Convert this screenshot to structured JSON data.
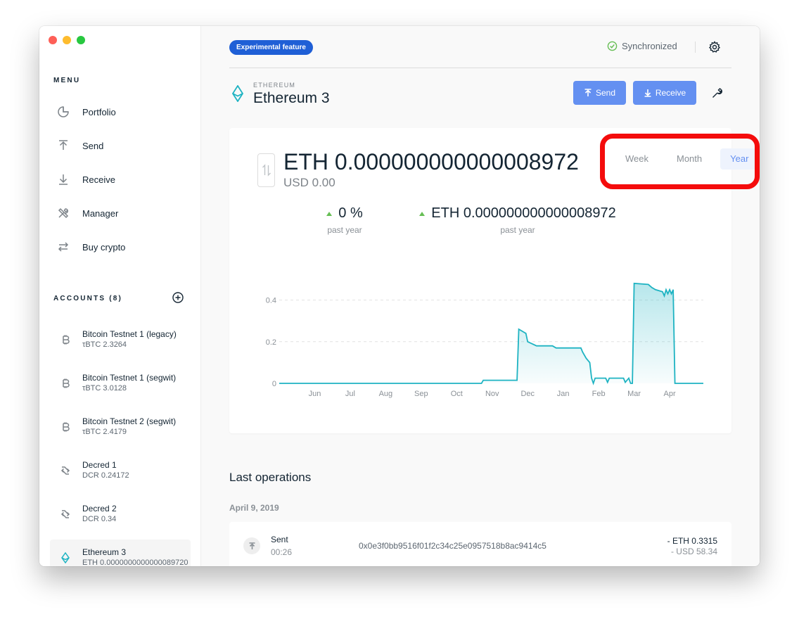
{
  "sidebar": {
    "menu_title": "MENU",
    "menu": [
      {
        "label": "Portfolio",
        "icon": "pie-chart-icon"
      },
      {
        "label": "Send",
        "icon": "arrow-up-icon"
      },
      {
        "label": "Receive",
        "icon": "arrow-down-icon"
      },
      {
        "label": "Manager",
        "icon": "tools-icon"
      },
      {
        "label": "Buy crypto",
        "icon": "exchange-icon"
      }
    ],
    "accounts_title": "ACCOUNTS (8)",
    "accounts": [
      {
        "name": "Bitcoin Testnet 1 (legacy)",
        "balance": "τBTC 2.3264",
        "icon": "bitcoin-icon"
      },
      {
        "name": "Bitcoin Testnet 1 (segwit)",
        "balance": "τBTC 3.0128",
        "icon": "bitcoin-icon"
      },
      {
        "name": "Bitcoin Testnet 2 (segwit)",
        "balance": "τBTC 2.4179",
        "icon": "bitcoin-icon"
      },
      {
        "name": "Decred 1",
        "balance": "DCR 0.24172",
        "icon": "decred-icon"
      },
      {
        "name": "Decred 2",
        "balance": "DCR 0.34",
        "icon": "decred-icon"
      },
      {
        "name": "Ethereum 3",
        "balance": "ETH 0.0000000000000089720",
        "icon": "ethereum-icon",
        "active": true
      }
    ]
  },
  "topbar": {
    "badge": "Experimental feature",
    "sync_status": "Synchronized"
  },
  "account": {
    "currency_label": "ETHEREUM",
    "name": "Ethereum 3",
    "send_label": "Send",
    "receive_label": "Receive"
  },
  "balance": {
    "main": "ETH 0.000000000000008972",
    "fiat": "USD 0.00",
    "ranges": [
      "Week",
      "Month",
      "Year"
    ],
    "selected_range": "Year",
    "stat_pct": "0 %",
    "stat_pct_label": "past year",
    "stat_amount": "ETH 0.000000000000008972",
    "stat_amount_label": "past year"
  },
  "chart_data": {
    "type": "area",
    "x_ticks": [
      "Jun",
      "Jul",
      "Aug",
      "Sep",
      "Oct",
      "Nov",
      "Dec",
      "Jan",
      "Feb",
      "Mar",
      "Apr"
    ],
    "y_ticks": [
      0,
      0.2,
      0.4
    ],
    "ylim": [
      0,
      0.5
    ],
    "xlim": [
      0,
      11.95
    ],
    "grid": true,
    "color": "#1eb3c2",
    "series": [
      {
        "points": [
          [
            0,
            0
          ],
          [
            5.7,
            0
          ],
          [
            5.75,
            0.015
          ],
          [
            6.7,
            0.015
          ],
          [
            6.75,
            0.26
          ],
          [
            6.85,
            0.25
          ],
          [
            6.95,
            0.24
          ],
          [
            7.0,
            0.2
          ],
          [
            7.25,
            0.18
          ],
          [
            7.7,
            0.18
          ],
          [
            7.8,
            0.17
          ],
          [
            8.5,
            0.17
          ],
          [
            8.55,
            0.15
          ],
          [
            8.65,
            0.12
          ],
          [
            8.75,
            0.1
          ],
          [
            8.8,
            0.025
          ],
          [
            8.85,
            0.0
          ],
          [
            8.9,
            0.025
          ],
          [
            9.2,
            0.025
          ],
          [
            9.25,
            0.005
          ],
          [
            9.3,
            0.025
          ],
          [
            9.7,
            0.025
          ],
          [
            9.75,
            0.005
          ],
          [
            9.85,
            0.025
          ],
          [
            9.9,
            0.0
          ],
          [
            9.95,
            0.0
          ],
          [
            10.0,
            0.48
          ],
          [
            10.4,
            0.475
          ],
          [
            10.5,
            0.46
          ],
          [
            10.6,
            0.45
          ],
          [
            10.8,
            0.44
          ],
          [
            10.85,
            0.42
          ],
          [
            10.9,
            0.45
          ],
          [
            10.95,
            0.43
          ],
          [
            11.0,
            0.45
          ],
          [
            11.05,
            0.43
          ],
          [
            11.1,
            0.45
          ],
          [
            11.15,
            0.0
          ],
          [
            11.95,
            0.0
          ]
        ]
      }
    ]
  },
  "operations": {
    "title": "Last operations",
    "date": "April 9, 2019",
    "items": [
      {
        "type": "Sent",
        "time": "00:26",
        "hash": "0x0e3f0bb9516f01f2c34c25e0957518b8ac9414c5",
        "amount": "- ETH 0.3315",
        "fiat": "- USD 58.34"
      }
    ]
  }
}
